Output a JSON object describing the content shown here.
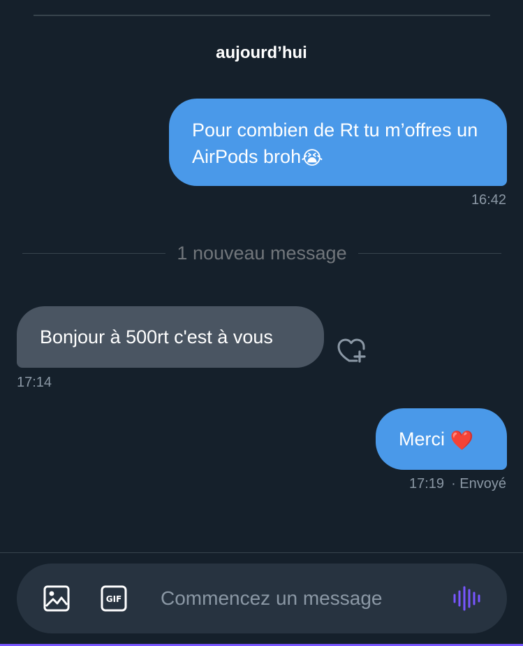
{
  "conversation": {
    "date_label": "aujourd’hui",
    "new_messages_label": "1 nouveau message"
  },
  "messages": [
    {
      "direction": "sent",
      "text": "Pour combien de Rt tu m’offres un AirPods broh",
      "emoji": "😭",
      "time": "16:42"
    },
    {
      "direction": "received",
      "text": "Bonjour à 500rt c'est à vous",
      "time": "17:14",
      "reaction_icon": "add-reaction-heart-icon"
    },
    {
      "direction": "sent",
      "text": "Merci",
      "emoji": "❤️",
      "time": "17:19",
      "status": "· Envoyé"
    }
  ],
  "composer": {
    "placeholder": "Commencez un message",
    "icons": [
      "image-icon",
      "gif-icon",
      "voice-message-icon"
    ]
  },
  "colors": {
    "background": "#15202b",
    "sent_bubble": "#4a99e9",
    "received_bubble": "#4a5562",
    "muted_text": "#8b98a5",
    "accent": "#7856ff",
    "heart": "#dd2e44"
  }
}
